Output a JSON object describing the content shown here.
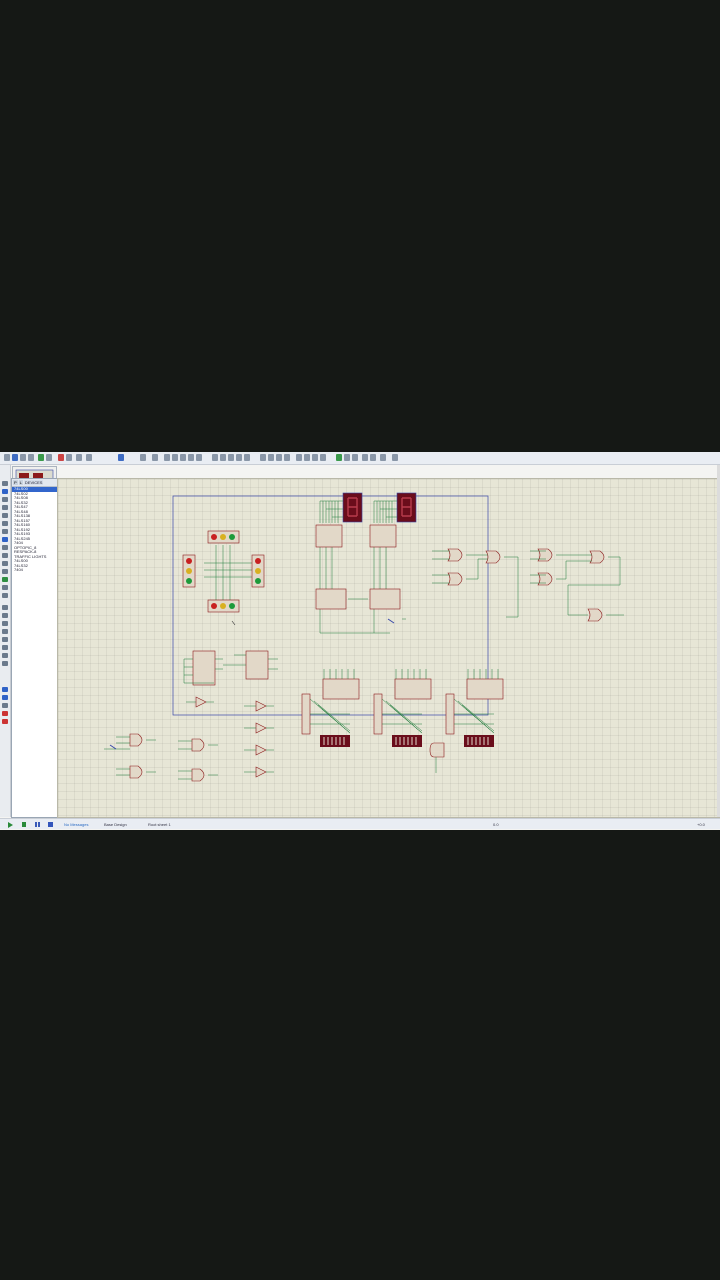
{
  "device_panel": {
    "header_label": "DEVICES",
    "tab_p": "P",
    "tab_l": "L",
    "items": [
      "74LS00",
      "74LS02",
      "74LS08",
      "74LS32",
      "74LS47",
      "74LS48",
      "74LS138",
      "74LS157",
      "74LS160",
      "74LS192",
      "74LS193",
      "74LS245",
      "7404",
      "OPTOPIC_8",
      "RESPACK-8",
      "TRAFFIC LIGHTS",
      "74LS00",
      "74LS32",
      "7404"
    ],
    "selected_index": 0
  },
  "status_bar": {
    "messages": "No Messages",
    "design": "Base Design",
    "sheet": "Root sheet 1",
    "coords": "0.0",
    "zoom": "+0.0"
  },
  "schematic": {
    "seven_segment_count": 2,
    "chip_labels": [
      "U7",
      "U8",
      "U9",
      "U10",
      "U1",
      "U2",
      "U3",
      "U4",
      "U5",
      "U6"
    ],
    "gate_labels": [
      "U9:A",
      "U9:B",
      "U9:C",
      "U9:D",
      "U10:A",
      "U10:B",
      "U11:A",
      "U11:B",
      "U12:A",
      "U12:B",
      "U12:C",
      "U12:D",
      "U13:A"
    ],
    "dsw_labels": [
      "DSW1",
      "DSW2",
      "DSW3"
    ],
    "rp_labels": [
      "RP1",
      "RP2",
      "RP3"
    ]
  },
  "colors": {
    "canvas": "#e7e6d6",
    "wire": "#1e7a3a",
    "component": "#8b1a1a",
    "component_fill": "#e2d8c8",
    "sheet_border": "#3848a8",
    "led_red": "#c82020",
    "led_yellow": "#d8b020",
    "led_green": "#1d9a3a",
    "seg_display": "#6a0d1b"
  }
}
